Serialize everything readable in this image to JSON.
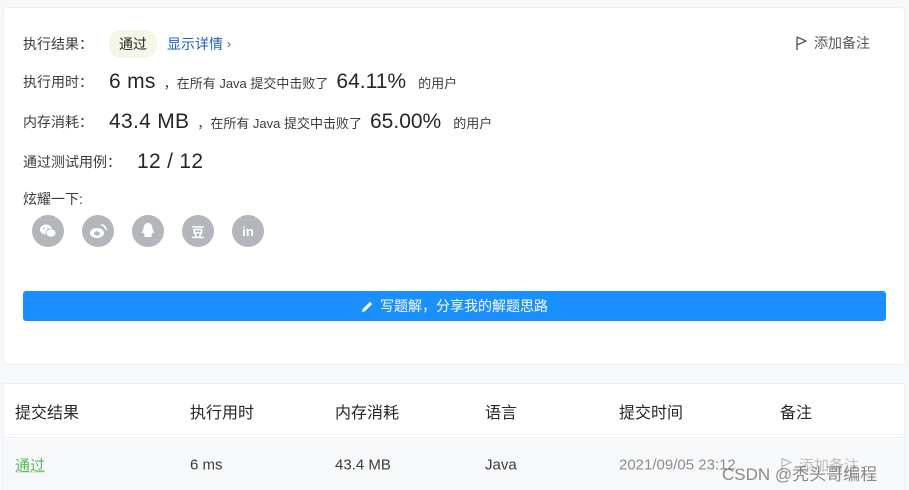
{
  "result": {
    "label": "执行结果：",
    "status": "通过",
    "detail_link": "显示详情",
    "add_note": "添加备注"
  },
  "runtime": {
    "label": "执行用时：",
    "value": "6 ms",
    "text": "，在所有 Java 提交中击败了",
    "percent": "64.11%",
    "suffix": "的用户"
  },
  "memory": {
    "label": "内存消耗：",
    "value": "43.4 MB",
    "text": "，在所有 Java 提交中击败了",
    "percent": "65.00%",
    "suffix": "的用户"
  },
  "testcases": {
    "label": "通过测试用例：",
    "value": "12 / 12"
  },
  "share": {
    "label": "炫耀一下:",
    "icons": [
      "wechat-icon",
      "weibo-icon",
      "qq-icon",
      "douban-icon",
      "linkedin-icon"
    ],
    "douban_glyph": "豆",
    "linkedin_glyph": "in"
  },
  "write_solution": "写题解，分享我的解题思路",
  "table": {
    "headers": [
      "提交结果",
      "执行用时",
      "内存消耗",
      "语言",
      "提交时间",
      "备注"
    ],
    "row": {
      "status": "通过",
      "runtime": "6 ms",
      "memory": "43.4 MB",
      "language": "Java",
      "time": "2021/09/05 23:12",
      "note": "添加备注"
    }
  },
  "watermark": "CSDN @秃头哥编程",
  "colors": {
    "accent": "#1a90ff",
    "pass": "#5cb85c",
    "link": "#1f5fbd"
  }
}
